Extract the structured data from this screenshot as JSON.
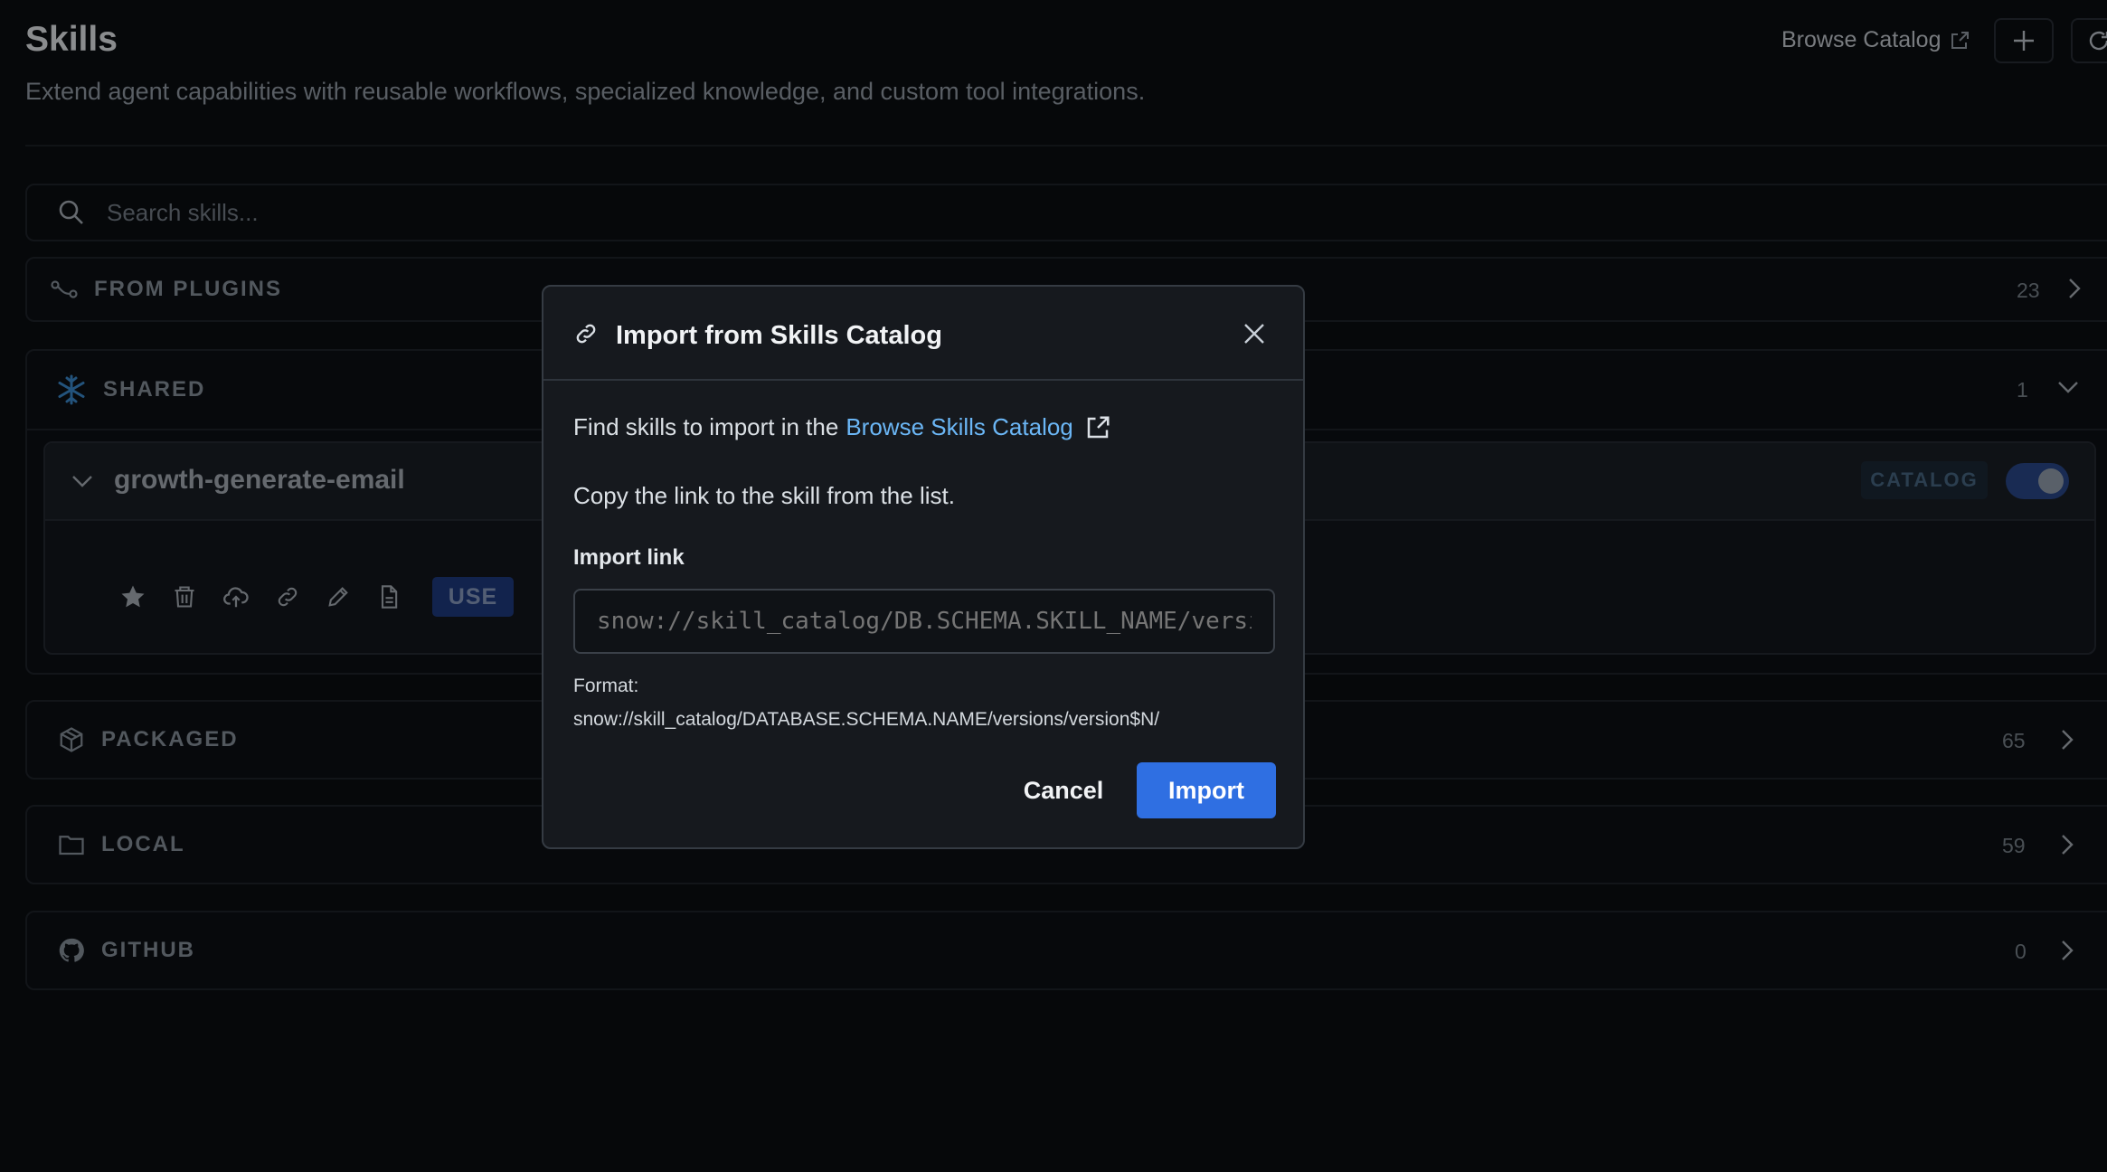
{
  "header": {
    "title": "Skills",
    "subtitle": "Extend agent capabilities with reusable workflows, specialized knowledge, and custom tool integrations.",
    "browse_catalog": "Browse Catalog"
  },
  "search": {
    "placeholder": "Search skills..."
  },
  "sections": {
    "from_plugins": {
      "label": "FROM PLUGINS",
      "count": "23"
    },
    "shared": {
      "label": "SHARED",
      "count": "1"
    },
    "packaged": {
      "label": "PACKAGED",
      "count": "65"
    },
    "local": {
      "label": "LOCAL",
      "count": "59"
    },
    "github": {
      "label": "GITHUB",
      "count": "0"
    }
  },
  "skill": {
    "name": "growth-generate-email",
    "badge": "CATALOG",
    "enabled": true,
    "use_label": "USE"
  },
  "modal": {
    "title": "Import from Skills Catalog",
    "find_prefix": "Find skills to import in the",
    "find_link": "Browse Skills Catalog",
    "copy_instruction": "Copy the link to the skill from the list.",
    "import_link_label": "Import link",
    "import_link_placeholder": "snow://skill_catalog/DB.SCHEMA.SKILL_NAME/versions/version$N/",
    "format_label": "Format:",
    "format_value": "snow://skill_catalog/DATABASE.SCHEMA.NAME/versions/version$N/",
    "cancel": "Cancel",
    "import": "Import"
  },
  "colors": {
    "accent": "#2f6fe2",
    "link": "#6bb6f5",
    "background": "#0b0e12"
  }
}
